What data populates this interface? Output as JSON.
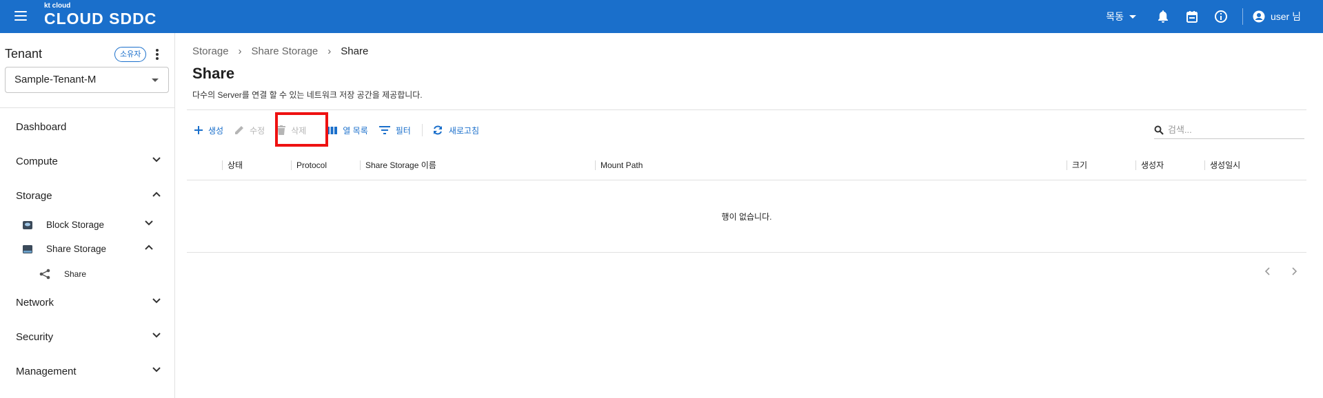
{
  "topbar": {
    "logo_small": "kt cloud",
    "logo_main": "CLOUD SDDC",
    "region": "목동",
    "user": "user 님"
  },
  "sidebar": {
    "tenant_title": "Tenant",
    "owner_badge": "소유자",
    "tenant_selected": "Sample-Tenant-M",
    "nav": {
      "dashboard": "Dashboard",
      "compute": "Compute",
      "storage": "Storage",
      "block_storage": "Block Storage",
      "share_storage": "Share Storage",
      "share": "Share",
      "network": "Network",
      "security": "Security",
      "management": "Management"
    }
  },
  "main": {
    "breadcrumb": [
      "Storage",
      "Share Storage",
      "Share"
    ],
    "title": "Share",
    "description": "다수의 Server를 연결 할 수 있는 네트워크 저장 공간을 제공합니다.",
    "toolbar": {
      "create": "생성",
      "edit": "수정",
      "delete": "삭제",
      "columns": "열 목록",
      "filter": "필터",
      "refresh": "새로고침"
    },
    "search_placeholder": "검색...",
    "columns": [
      "상태",
      "Protocol",
      "Share Storage 이름",
      "Mount Path",
      "크기",
      "생성자",
      "생성일시"
    ],
    "empty_message": "행이 없습니다."
  },
  "colors": {
    "brand": "#1a6fcb",
    "highlight": "#ee1111"
  }
}
